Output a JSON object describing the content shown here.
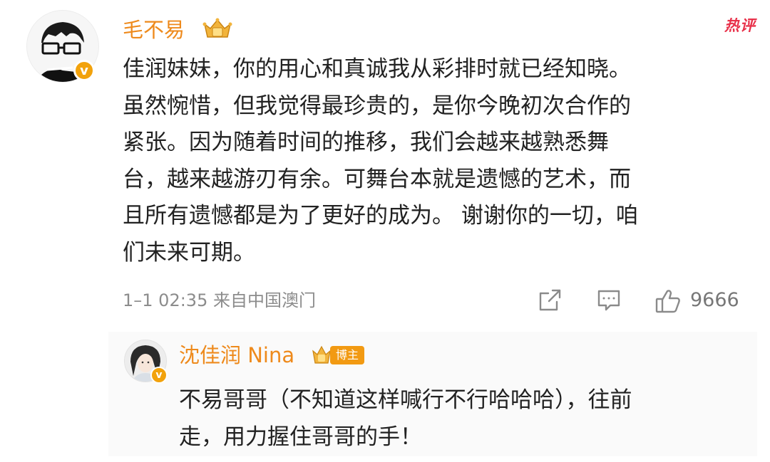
{
  "comment": {
    "username": "毛不易",
    "hot_tag": "热评",
    "text": "佳润妹妹，你的用心和真诚我从彩排时就已经知晓。\n虽然惋惜，但我觉得最珍贵的，是你今晚初次合作的\n紧张。因为随着时间的推移，我们会越来越熟悉舞\n台，越来越游刃有余。可舞台本就是遗憾的艺术，而\n且所有遗憾都是为了更好的成为。 谢谢你的一切，咱\n们未来可期。",
    "meta": "1–1 02:35  来自中国澳门",
    "like_count": "9666",
    "verified_mark": "v",
    "icons": [
      "avatar",
      "verified-icon",
      "crown-icon",
      "share-icon",
      "comment-icon",
      "like-icon"
    ]
  },
  "reply": {
    "username": "沈佳润 Nina",
    "badge": "博主",
    "text": "不易哥哥（不知道这样喊行不行哈哈哈），往前\n走，用力握住哥哥的手！",
    "verified_mark": "v",
    "icons": [
      "avatar",
      "verified-icon",
      "crown-icon"
    ]
  },
  "colors": {
    "username": "#ee8a1c",
    "hot_tag": "#e8314a",
    "badge": "#f29a12",
    "text": "#222222",
    "meta": "#8c8c8c"
  }
}
